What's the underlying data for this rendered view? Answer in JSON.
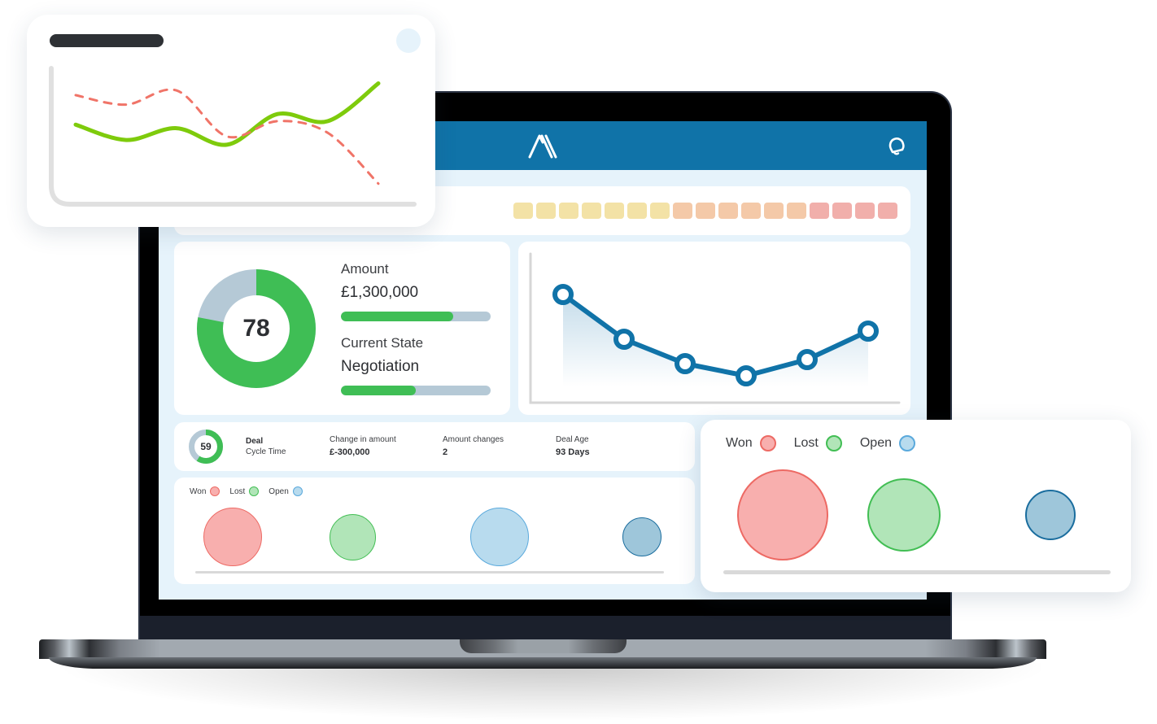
{
  "app": {
    "logo_icon": "double-chevron-logo-icon",
    "notification_icon": "bell-icon",
    "brand_color": "#1073a8"
  },
  "heat_strip": {
    "cells": [
      "#f3e2a6",
      "#f3e2a6",
      "#f3e2a6",
      "#f3e2a6",
      "#f3e2a6",
      "#f3e2a6",
      "#f3e2a6",
      "#f4c9a8",
      "#f4c9a8",
      "#f4c9a8",
      "#f4c9a8",
      "#f4c9a8",
      "#f4c9a8",
      "#f1afab",
      "#f1afab",
      "#f1afab",
      "#f1afab"
    ]
  },
  "score_card": {
    "score": "78",
    "score_fraction": 0.78,
    "amount_label": "Amount",
    "amount_value": "£1,300,000",
    "amount_progress": 0.75,
    "state_label": "Current State",
    "state_value": "Negotiation",
    "state_progress": 0.5
  },
  "trend_chart": {
    "type": "line",
    "values": [
      82,
      60,
      48,
      42,
      50,
      64
    ],
    "ylim": [
      0,
      100
    ],
    "color": "#1073a8"
  },
  "stats": {
    "cycle_score": "59",
    "cycle_fraction": 0.59,
    "cycle_label_1": "Deal",
    "cycle_label_2": "Cycle Time",
    "change_label": "Change in amount",
    "change_value": "£-300,000",
    "changes_label": "Amount changes",
    "changes_value": "2",
    "age_label": "Deal Age",
    "age_value": "93 Days"
  },
  "bubble_legend": [
    {
      "label": "Won",
      "fill": "#f8afae",
      "stroke": "#ed6a64"
    },
    {
      "label": "Lost",
      "fill": "#b1e5b8",
      "stroke": "#42be54"
    },
    {
      "label": "Open",
      "fill": "#b8dbee",
      "stroke": "#5aa9dc"
    }
  ],
  "bubbles_small": [
    {
      "category": "Won",
      "size": 72,
      "fill": "#f8afae",
      "stroke": "#ed6a64"
    },
    {
      "category": "Lost",
      "size": 57,
      "fill": "#b1e5b8",
      "stroke": "#42be54"
    },
    {
      "category": "Open",
      "size": 72,
      "fill": "#b8dbee",
      "stroke": "#5aa9dc"
    },
    {
      "category": "Open",
      "size": 48,
      "fill": "#9ec6da",
      "stroke": "#1a6d9e"
    }
  ],
  "bubbles_large": [
    {
      "category": "Won",
      "size": 112,
      "fill": "#f8afae",
      "stroke": "#ed6a64"
    },
    {
      "category": "Lost",
      "size": 90,
      "fill": "#b1e5b8",
      "stroke": "#42be54"
    },
    {
      "category": "Open",
      "size": 62,
      "fill": "#9ec6da",
      "stroke": "#1a6d9e"
    }
  ],
  "float_line_chart": {
    "type": "line",
    "series": [
      {
        "name": "green-solid",
        "color": "#7ecb0c",
        "style": "solid",
        "values": [
          55,
          42,
          52,
          38,
          64,
          58,
          90
        ]
      },
      {
        "name": "red-dashed",
        "color": "#f07468",
        "style": "dashed",
        "values": [
          80,
          72,
          84,
          45,
          58,
          48,
          5
        ]
      }
    ],
    "ylim": [
      0,
      100
    ]
  }
}
